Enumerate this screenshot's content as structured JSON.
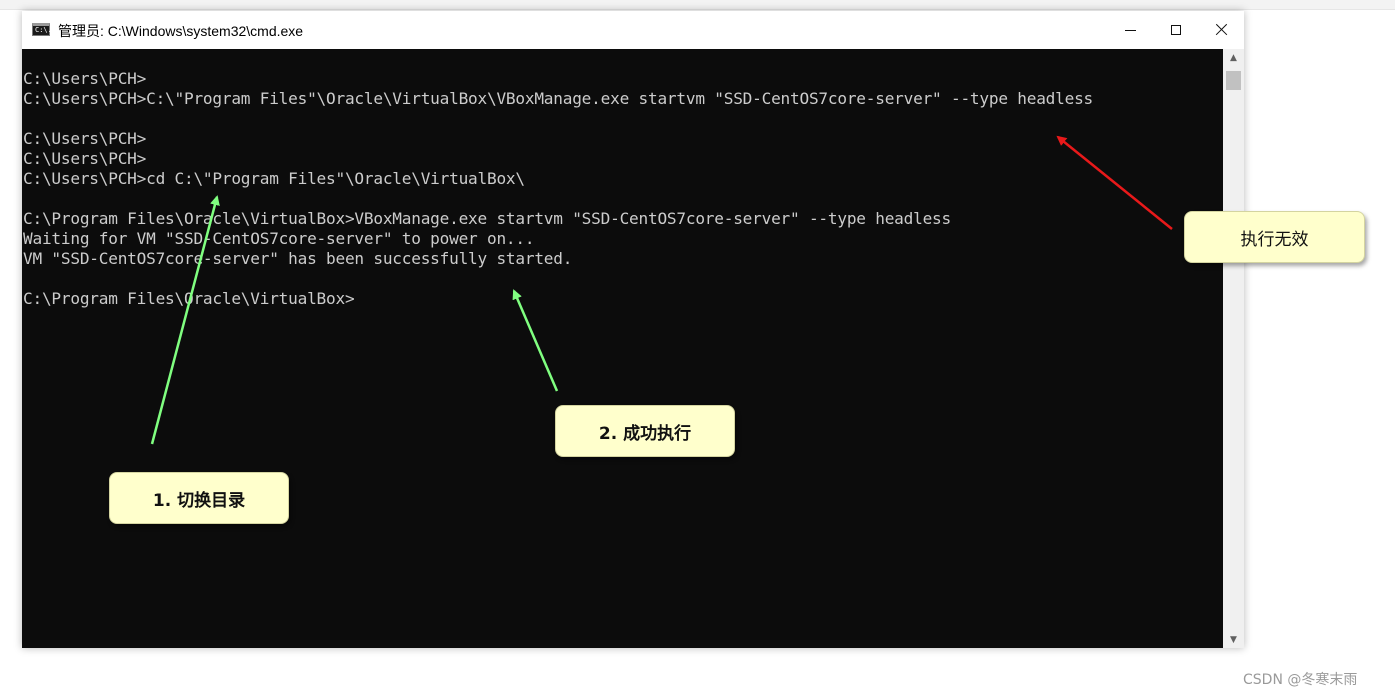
{
  "window": {
    "title": "管理员: C:\\Windows\\system32\\cmd.exe",
    "app_icon_text": "C:\\.",
    "controls": {
      "minimize_icon": "minimize-icon",
      "maximize_icon": "maximize-icon",
      "close_icon": "close-icon"
    }
  },
  "console": {
    "background": "#0c0c0c",
    "text_color": "#cccccc",
    "lines": [
      "C:\\Users\\PCH>",
      "C:\\Users\\PCH>C:\\\"Program Files\"\\Oracle\\VirtualBox\\VBoxManage.exe startvm \"SSD-CentOS7core-server\" --type headless",
      "",
      "C:\\Users\\PCH>",
      "C:\\Users\\PCH>",
      "C:\\Users\\PCH>cd C:\\\"Program Files\"\\Oracle\\VirtualBox\\",
      "",
      "C:\\Program Files\\Oracle\\VirtualBox>VBoxManage.exe startvm \"SSD-CentOS7core-server\" --type headless",
      "Waiting for VM \"SSD-CentOS7core-server\" to power on...",
      "VM \"SSD-CentOS7core-server\" has been successfully started.",
      "",
      "C:\\Program Files\\Oracle\\VirtualBox>"
    ]
  },
  "annotations": {
    "invalid": {
      "text": "执行无效",
      "arrow_color": "#e8191a"
    },
    "success": {
      "text": "2. 成功执行",
      "arrow_color": "#80ff80"
    },
    "cd": {
      "text": "1. 切换目录",
      "arrow_color": "#80ff80"
    }
  },
  "watermark": "CSDN @冬寒末雨"
}
